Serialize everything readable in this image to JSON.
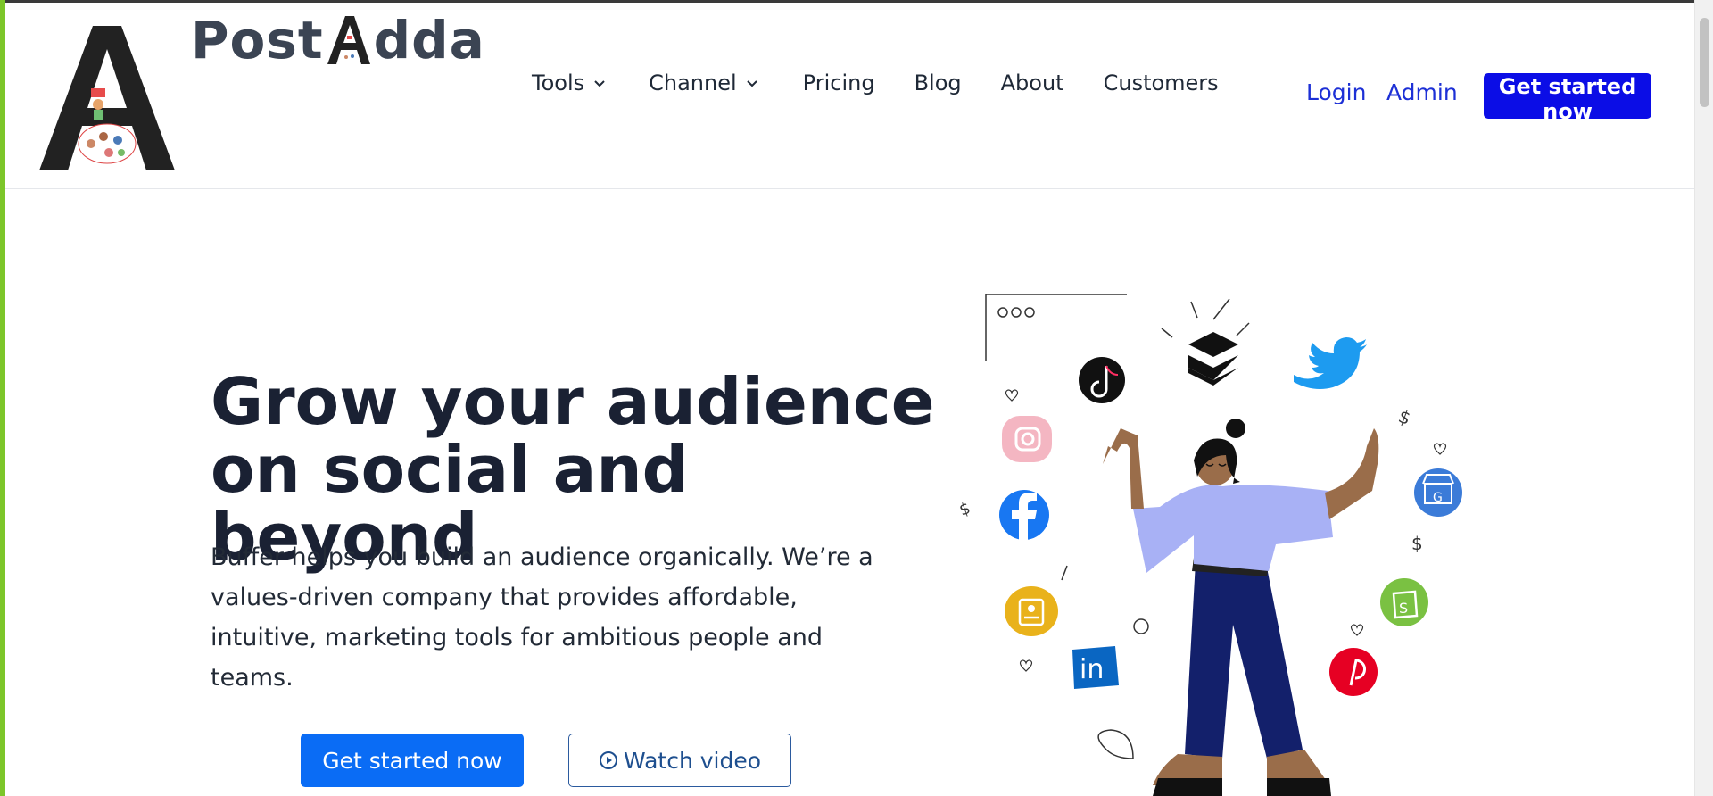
{
  "brand": {
    "name_left": "Post",
    "name_right": "dda"
  },
  "nav": {
    "items": [
      {
        "label": "Tools",
        "has_dropdown": true
      },
      {
        "label": "Channel",
        "has_dropdown": true
      },
      {
        "label": "Pricing",
        "has_dropdown": false
      },
      {
        "label": "Blog",
        "has_dropdown": false
      },
      {
        "label": "About",
        "has_dropdown": false
      },
      {
        "label": "Customers",
        "has_dropdown": false
      }
    ],
    "login": "Login",
    "admin": "Admin",
    "cta": "Get started now"
  },
  "hero": {
    "title_line1": "Grow your audience",
    "title_line2": "on social and beyond",
    "body": "Buffer helps you build an audience organically. We’re a values-driven company that provides affordable, intuitive, marketing tools for ambitious people and teams.",
    "primary_button": "Get started now",
    "secondary_button": "Watch video"
  },
  "colors": {
    "accent": "#0b0de6",
    "primary_button": "#0a6cf5",
    "link": "#1d30d6",
    "frame_green": "#7cc62a"
  },
  "icons": {
    "social": [
      "tiktok-icon",
      "buffer-icon",
      "twitter-icon",
      "instagram-icon",
      "facebook-icon",
      "linkedin-icon",
      "google-business-icon",
      "shopify-icon",
      "pinterest-icon",
      "contact-card-icon"
    ]
  }
}
